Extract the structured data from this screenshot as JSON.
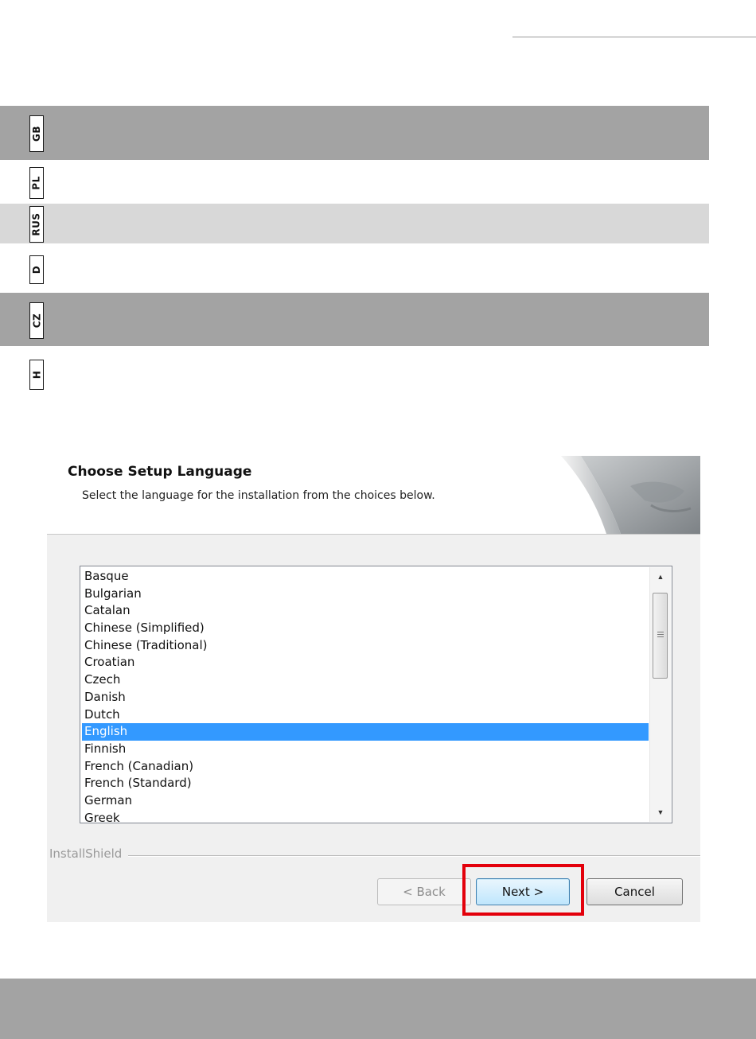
{
  "language_tabs": [
    {
      "code": "GB"
    },
    {
      "code": "PL"
    },
    {
      "code": "RUS"
    },
    {
      "code": "D"
    },
    {
      "code": "CZ"
    },
    {
      "code": "H"
    }
  ],
  "colors": {
    "band_dark": "#a3a3a3",
    "band_light": "#d8d8d8",
    "selection": "#3399ff",
    "highlight": "#e3000b"
  },
  "dialog": {
    "title": "Choose Setup Language",
    "subtitle": "Select the language for the installation from the choices below.",
    "languages": [
      "Basque",
      "Bulgarian",
      "Catalan",
      "Chinese (Simplified)",
      "Chinese (Traditional)",
      "Croatian",
      "Czech",
      "Danish",
      "Dutch",
      "English",
      "Finnish",
      "French (Canadian)",
      "French (Standard)",
      "German",
      "Greek"
    ],
    "selected_language": "English",
    "brand": "InstallShield",
    "buttons": {
      "back": "< Back",
      "next": "Next >",
      "cancel": "Cancel"
    },
    "back_enabled": false
  }
}
